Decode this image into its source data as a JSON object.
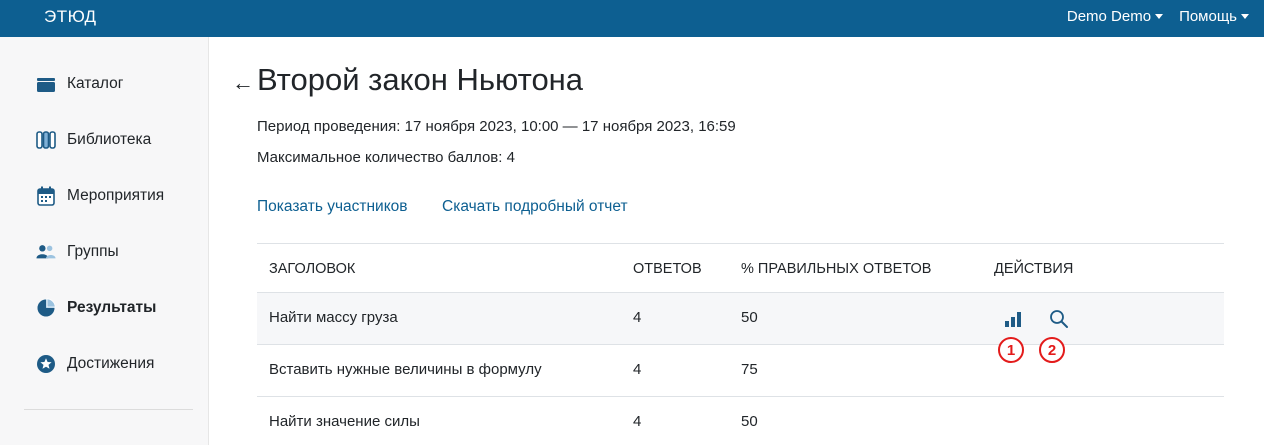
{
  "header": {
    "logo": "ЭТЮД",
    "user_menu": "Demo Demo",
    "help_menu": "Помощь"
  },
  "sidebar": {
    "items": [
      {
        "label": "Каталог",
        "icon": "catalog-icon"
      },
      {
        "label": "Библиотека",
        "icon": "library-icon"
      },
      {
        "label": "Мероприятия",
        "icon": "calendar-icon"
      },
      {
        "label": "Группы",
        "icon": "users-icon"
      },
      {
        "label": "Результаты",
        "icon": "pie-chart-icon",
        "active": true
      },
      {
        "label": "Достижения",
        "icon": "star-icon"
      }
    ]
  },
  "main": {
    "back": "←",
    "title": "Второй закон Ньютона",
    "period": "Период проведения: 17 ноября 2023, 10:00 — 17 ноября 2023, 16:59",
    "max_score": "Максимальное количество баллов: 4",
    "links": {
      "show_participants": "Показать участников",
      "download_report": "Скачать подробный отчет"
    }
  },
  "table": {
    "headers": [
      "Заголовок",
      "Ответов",
      "% правильных ответов",
      "Действия"
    ],
    "rows": [
      {
        "title": "Найти массу груза",
        "answers": "4",
        "percent": "50"
      },
      {
        "title": "Вставить нужные величины в формулу",
        "answers": "4",
        "percent": "75"
      },
      {
        "title": "Найти значение силы",
        "answers": "4",
        "percent": "50"
      }
    ]
  },
  "annotations": [
    "1",
    "2"
  ],
  "colors": {
    "brand": "#0d5f91",
    "annotation": "#e31b1b"
  }
}
